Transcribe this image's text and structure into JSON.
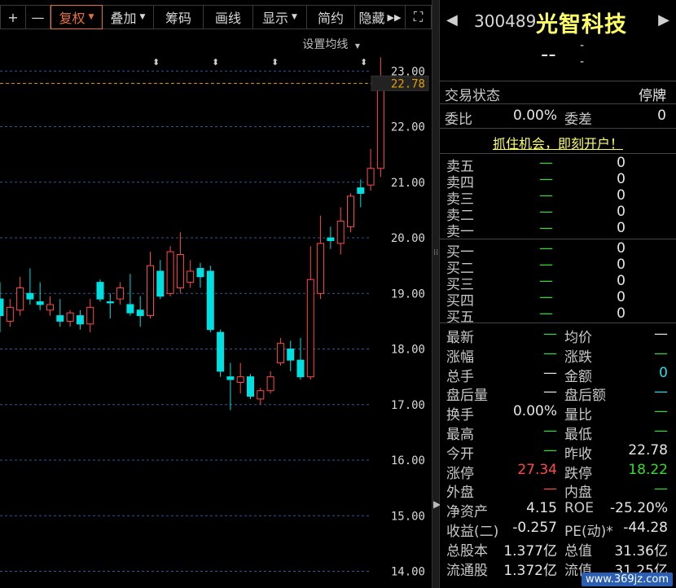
{
  "toolbar": {
    "items": [
      {
        "label": "+",
        "icon": "plus-icon"
      },
      {
        "label": "—",
        "icon": "minus-icon"
      },
      {
        "label": "复权"
      },
      {
        "label": "叠加"
      },
      {
        "label": "筹码"
      },
      {
        "label": "画线"
      },
      {
        "label": "显示"
      },
      {
        "label": "简约"
      },
      {
        "label": "隐藏"
      },
      {
        "label": "⛶",
        "icon": "fullscreen-icon"
      }
    ]
  },
  "ma_setting_label": "设置均线",
  "colors": {
    "up": "#ff4a4a",
    "down": "#00e0e0",
    "grid": "#2a5a9a",
    "prevclose": "#e0a000",
    "name": "#ffff66",
    "accent": "#e8703a"
  },
  "chart_data": {
    "type": "candlestick",
    "y_ticks": [
      "23.00",
      "22.00",
      "21.00",
      "20.00",
      "19.00",
      "18.00",
      "17.00",
      "16.00",
      "15.00",
      "14.00"
    ],
    "ylim": [
      13.7,
      23.4
    ],
    "reference_price": 22.78,
    "reference_label": "22.78",
    "candles": [
      {
        "o": 18.9,
        "c": 18.6,
        "h": 19.2,
        "l": 18.3
      },
      {
        "o": 18.5,
        "c": 18.75,
        "h": 18.9,
        "l": 18.4
      },
      {
        "o": 18.7,
        "c": 19.1,
        "h": 19.3,
        "l": 18.6
      },
      {
        "o": 19.0,
        "c": 18.9,
        "h": 19.45,
        "l": 18.8
      },
      {
        "o": 18.85,
        "c": 18.8,
        "h": 19.2,
        "l": 18.7
      },
      {
        "o": 18.7,
        "c": 18.8,
        "h": 18.95,
        "l": 18.6
      },
      {
        "o": 18.6,
        "c": 18.5,
        "h": 18.9,
        "l": 18.4
      },
      {
        "o": 18.5,
        "c": 18.65,
        "h": 18.7,
        "l": 18.4
      },
      {
        "o": 18.6,
        "c": 18.45,
        "h": 18.7,
        "l": 18.35
      },
      {
        "o": 18.45,
        "c": 18.75,
        "h": 18.9,
        "l": 18.3
      },
      {
        "o": 19.2,
        "c": 18.9,
        "h": 19.25,
        "l": 18.85
      },
      {
        "o": 18.85,
        "c": 18.83,
        "h": 19.0,
        "l": 18.55
      },
      {
        "o": 18.9,
        "c": 19.1,
        "h": 19.2,
        "l": 18.8
      },
      {
        "o": 18.8,
        "c": 18.65,
        "h": 19.35,
        "l": 18.6
      },
      {
        "o": 18.7,
        "c": 18.6,
        "h": 18.95,
        "l": 18.4
      },
      {
        "o": 18.6,
        "c": 19.5,
        "h": 19.75,
        "l": 18.55
      },
      {
        "o": 19.4,
        "c": 18.95,
        "h": 19.6,
        "l": 18.9
      },
      {
        "o": 19.0,
        "c": 19.75,
        "h": 19.85,
        "l": 18.95
      },
      {
        "o": 19.1,
        "c": 19.7,
        "h": 20.1,
        "l": 19.0
      },
      {
        "o": 19.2,
        "c": 19.4,
        "h": 19.6,
        "l": 19.1
      },
      {
        "o": 19.45,
        "c": 19.3,
        "h": 19.55,
        "l": 19.1
      },
      {
        "o": 19.4,
        "c": 18.35,
        "h": 19.5,
        "l": 18.3
      },
      {
        "o": 18.3,
        "c": 17.6,
        "h": 18.35,
        "l": 17.5
      },
      {
        "o": 17.5,
        "c": 17.45,
        "h": 17.75,
        "l": 16.9
      },
      {
        "o": 17.4,
        "c": 17.5,
        "h": 17.75,
        "l": 17.2
      },
      {
        "o": 17.5,
        "c": 17.15,
        "h": 17.55,
        "l": 17.1
      },
      {
        "o": 17.1,
        "c": 17.25,
        "h": 17.3,
        "l": 17.0
      },
      {
        "o": 17.25,
        "c": 17.5,
        "h": 17.6,
        "l": 17.2
      },
      {
        "o": 17.75,
        "c": 18.1,
        "h": 18.2,
        "l": 17.7
      },
      {
        "o": 18.0,
        "c": 17.8,
        "h": 18.15,
        "l": 17.6
      },
      {
        "o": 17.8,
        "c": 17.5,
        "h": 18.2,
        "l": 17.45
      },
      {
        "o": 17.5,
        "c": 19.25,
        "h": 19.85,
        "l": 17.45
      },
      {
        "o": 19.0,
        "c": 19.9,
        "h": 20.4,
        "l": 18.9
      },
      {
        "o": 20.0,
        "c": 19.95,
        "h": 20.2,
        "l": 19.8
      },
      {
        "o": 19.9,
        "c": 20.3,
        "h": 20.55,
        "l": 19.7
      },
      {
        "o": 20.2,
        "c": 20.75,
        "h": 20.8,
        "l": 20.1
      },
      {
        "o": 20.9,
        "c": 20.8,
        "h": 21.05,
        "l": 20.55
      },
      {
        "o": 20.95,
        "c": 21.25,
        "h": 21.6,
        "l": 20.85
      },
      {
        "o": 21.25,
        "c": 22.78,
        "h": 23.25,
        "l": 21.1
      }
    ]
  },
  "header": {
    "code": "300489",
    "name": "光智科技",
    "price": "--",
    "change": "-",
    "change_pct": "-"
  },
  "trade_status": {
    "label": "交易状态",
    "value": "停牌"
  },
  "ratio": {
    "label1": "委比",
    "value1": "0.00%",
    "label2": "委差",
    "value2": "0"
  },
  "promo": "抓住机会，即刻开户！",
  "sell_book": [
    {
      "label": "卖五",
      "price": "—",
      "vol": "0"
    },
    {
      "label": "卖四",
      "price": "—",
      "vol": "0"
    },
    {
      "label": "卖三",
      "price": "—",
      "vol": "0"
    },
    {
      "label": "卖二",
      "price": "—",
      "vol": "0"
    },
    {
      "label": "卖一",
      "price": "—",
      "vol": "0"
    }
  ],
  "buy_book": [
    {
      "label": "买一",
      "price": "—",
      "vol": "0"
    },
    {
      "label": "买二",
      "price": "—",
      "vol": "0"
    },
    {
      "label": "买三",
      "price": "—",
      "vol": "0"
    },
    {
      "label": "买四",
      "price": "—",
      "vol": "0"
    },
    {
      "label": "买五",
      "price": "—",
      "vol": "0"
    }
  ],
  "stats": [
    {
      "l1": "最新",
      "v1": "—",
      "c1": "green",
      "l2": "均价",
      "v2": "—",
      "c2": "num"
    },
    {
      "l1": "涨幅",
      "v1": "—",
      "c1": "green",
      "l2": "涨跌",
      "v2": "—",
      "c2": "green"
    },
    {
      "l1": "总手",
      "v1": "—",
      "c1": "num",
      "l2": "金额",
      "v2": "0",
      "c2": "cyan"
    },
    {
      "l1": "盘后量",
      "v1": "—",
      "c1": "num",
      "l2": "盘后额",
      "v2": "—",
      "c2": "cyan"
    },
    {
      "l1": "换手",
      "v1": "0.00%",
      "c1": "num",
      "l2": "量比",
      "v2": "—",
      "c2": "green"
    },
    {
      "l1": "最高",
      "v1": "—",
      "c1": "green",
      "l2": "最低",
      "v2": "—",
      "c2": "green"
    },
    {
      "l1": "今开",
      "v1": "—",
      "c1": "green",
      "l2": "昨收",
      "v2": "22.78",
      "c2": "num"
    },
    {
      "l1": "涨停",
      "v1": "27.34",
      "c1": "red",
      "l2": "跌停",
      "v2": "18.22",
      "c2": "green"
    },
    {
      "l1": "外盘",
      "v1": "—",
      "c1": "red",
      "l2": "内盘",
      "v2": "—",
      "c2": "green"
    },
    {
      "l1": "净资产",
      "v1": "4.15",
      "c1": "num",
      "l2": "ROE",
      "v2": "-25.20%",
      "c2": "num"
    },
    {
      "l1": "收益(二)",
      "v1": "-0.257",
      "c1": "num",
      "l2": "PE(动)*",
      "v2": "-44.28",
      "c2": "num"
    },
    {
      "l1": "总股本",
      "v1": "1.377亿",
      "c1": "num",
      "l2": "总值",
      "v2": "31.36亿",
      "c2": "num"
    },
    {
      "l1": "流通股",
      "v1": "1.372亿",
      "c1": "num",
      "l2": "流值",
      "v2": "31.25亿",
      "c2": "num"
    }
  ],
  "watermark": "www.369jz.com"
}
